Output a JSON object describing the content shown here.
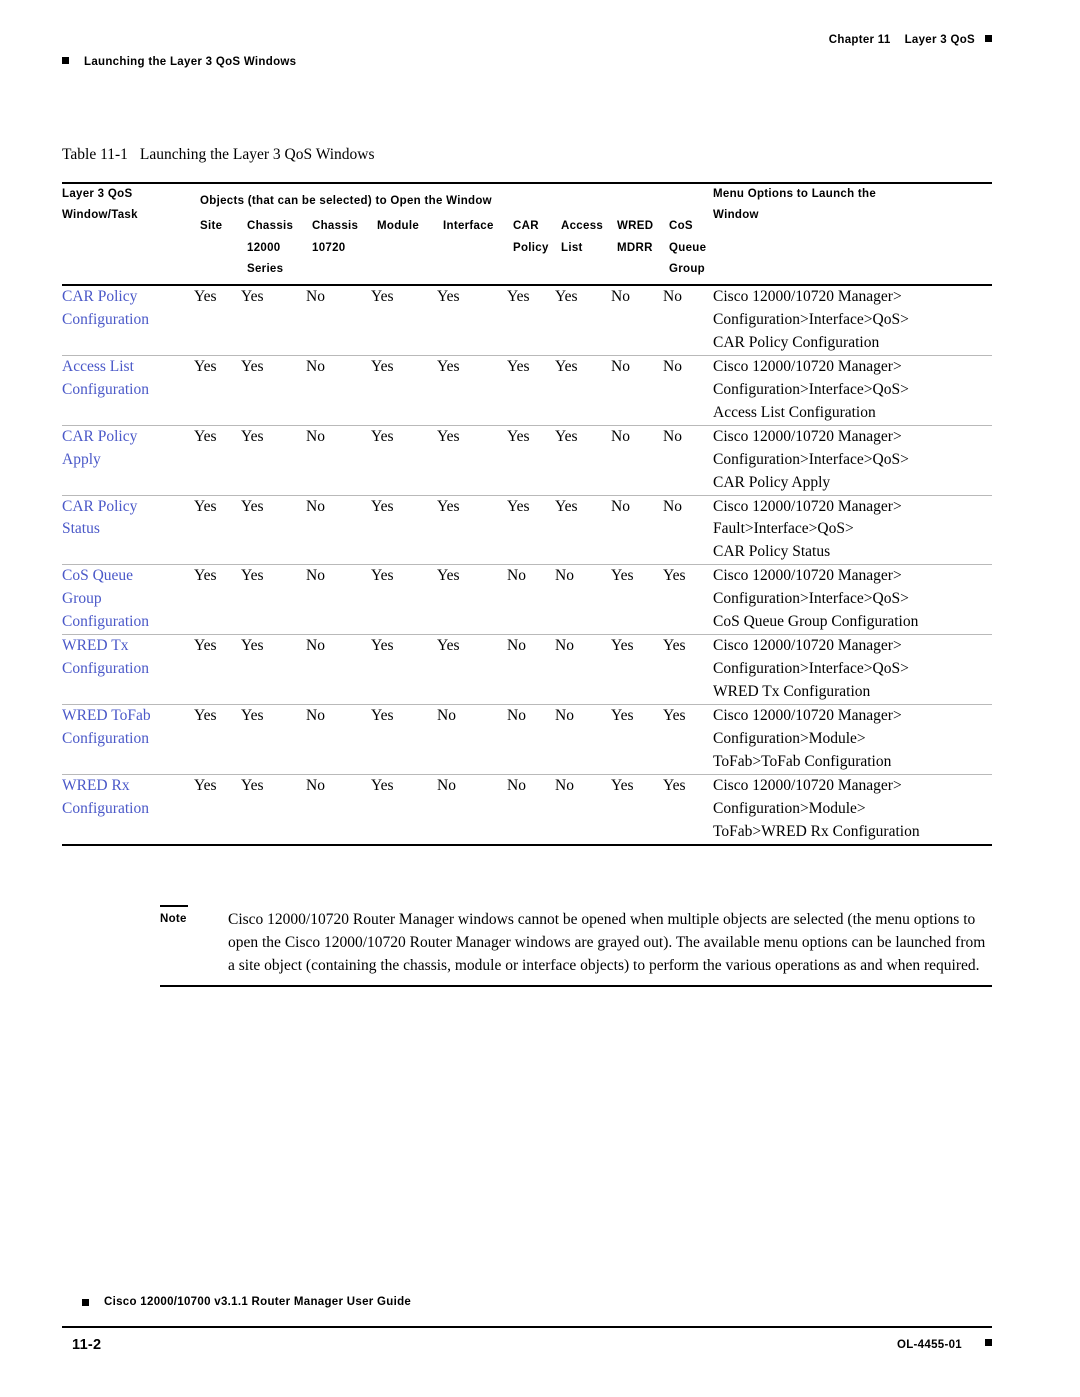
{
  "header": {
    "chapter_label": "Chapter    11",
    "chapter_title": "Layer 3 QoS",
    "running_head": "Launching the Layer 3 QoS Windows"
  },
  "table_caption": {
    "number": "Table 11-1",
    "title": "Launching the Layer 3 QoS Windows"
  },
  "table": {
    "header": {
      "col1_line1": "Layer 3 QoS",
      "col1_line2": "Window/Task",
      "group_title": "Objects (that can be selected) to Open the Window",
      "menu_line1": "Menu Options to Launch the",
      "menu_line2": "Window",
      "subcols": [
        {
          "l1": "Site",
          "l2": "",
          "l3": ""
        },
        {
          "l1": "Chassis",
          "l2": "12000",
          "l3": "Series"
        },
        {
          "l1": "Chassis",
          "l2": "10720",
          "l3": ""
        },
        {
          "l1": "Module",
          "l2": "",
          "l3": ""
        },
        {
          "l1": "Interface",
          "l2": "",
          "l3": ""
        },
        {
          "l1": "CAR",
          "l2": "Policy",
          "l3": ""
        },
        {
          "l1": "Access",
          "l2": "List",
          "l3": ""
        },
        {
          "l1": "WRED",
          "l2": "MDRR",
          "l3": ""
        },
        {
          "l1": "CoS",
          "l2": "Queue",
          "l3": "Group"
        }
      ]
    },
    "rows": [
      {
        "task": [
          "CAR Policy",
          "Configuration"
        ],
        "values": [
          "Yes",
          "Yes",
          "No",
          "Yes",
          "Yes",
          "Yes",
          "Yes",
          "No",
          "No"
        ],
        "menu": [
          "Cisco 12000/10720 Manager>",
          "Configuration>Interface>QoS>",
          "CAR Policy Configuration"
        ]
      },
      {
        "task": [
          "Access List",
          "Configuration"
        ],
        "values": [
          "Yes",
          "Yes",
          "No",
          "Yes",
          "Yes",
          "Yes",
          "Yes",
          "No",
          "No"
        ],
        "menu": [
          "Cisco 12000/10720 Manager>",
          "Configuration>Interface>QoS>",
          "Access List Configuration"
        ]
      },
      {
        "task": [
          "CAR Policy",
          "Apply"
        ],
        "values": [
          "Yes",
          "Yes",
          "No",
          "Yes",
          "Yes",
          "Yes",
          "Yes",
          "No",
          "No"
        ],
        "menu": [
          "Cisco 12000/10720 Manager>",
          "Configuration>Interface>QoS>",
          "CAR Policy Apply"
        ]
      },
      {
        "task": [
          "CAR Policy",
          "Status"
        ],
        "values": [
          "Yes",
          "Yes",
          "No",
          "Yes",
          "Yes",
          "Yes",
          "Yes",
          "No",
          "No"
        ],
        "menu": [
          "Cisco 12000/10720 Manager>",
          "Fault>Interface>QoS>",
          "CAR Policy Status"
        ]
      },
      {
        "task": [
          "CoS Queue",
          "Group",
          "Configuration"
        ],
        "values": [
          "Yes",
          "Yes",
          "No",
          "Yes",
          "Yes",
          "No",
          "No",
          "Yes",
          "Yes"
        ],
        "menu": [
          "Cisco 12000/10720 Manager>",
          "Configuration>Interface>QoS>",
          "CoS Queue Group Configuration"
        ]
      },
      {
        "task": [
          "WRED Tx",
          "Configuration"
        ],
        "values": [
          "Yes",
          "Yes",
          "No",
          "Yes",
          "Yes",
          "No",
          "No",
          "Yes",
          "Yes"
        ],
        "menu": [
          "Cisco 12000/10720 Manager>",
          "Configuration>Interface>QoS>",
          "WRED Tx Configuration"
        ]
      },
      {
        "task": [
          "WRED ToFab",
          "Configuration"
        ],
        "values": [
          "Yes",
          "Yes",
          "No",
          "Yes",
          "No",
          "No",
          "No",
          "Yes",
          "Yes"
        ],
        "menu": [
          "Cisco 12000/10720 Manager>",
          "Configuration>Module>",
          "ToFab>ToFab Configuration"
        ]
      },
      {
        "task": [
          "WRED Rx",
          "Configuration"
        ],
        "values": [
          "Yes",
          "Yes",
          "No",
          "Yes",
          "No",
          "No",
          "No",
          "Yes",
          "Yes"
        ],
        "menu": [
          "Cisco 12000/10720 Manager>",
          "Configuration>Module>",
          "ToFab>WRED Rx Configuration"
        ]
      }
    ]
  },
  "note": {
    "label": "Note",
    "text": "Cisco 12000/10720 Router Manager windows cannot be opened when multiple objects are selected (the menu options to open the Cisco 12000/10720 Router Manager windows are grayed out). The available menu options can be launched from a site object (containing the chassis, module or interface objects) to perform the various operations as and when required."
  },
  "footer": {
    "guide_title": "Cisco 12000/10700 v3.1.1 Router Manager User Guide",
    "page_number": "11-2",
    "doc_number": "OL-4455-01"
  },
  "colors": {
    "link": "#4a58c8",
    "rule": "#000000",
    "thin_rule": "#b9b9b9"
  }
}
